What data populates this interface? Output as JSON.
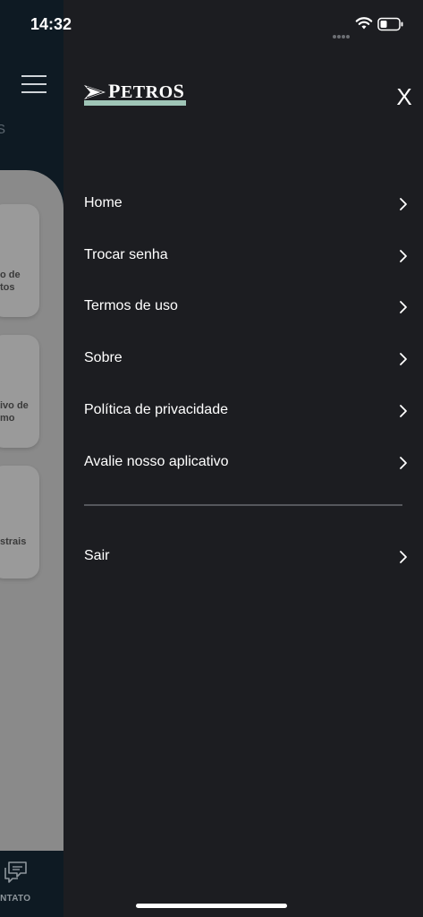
{
  "status_bar": {
    "time": "14:32"
  },
  "background_app": {
    "header_char": "S",
    "cards": [
      {
        "line1": "o de",
        "line2": "tos"
      },
      {
        "line1": "ivo de",
        "line2": "mo"
      },
      {
        "line1": "strais",
        "line2": ""
      }
    ],
    "bottom_tab_label": "ONTATO"
  },
  "drawer": {
    "logo": {
      "text_first": "P",
      "text_rest": "ETRO",
      "text_last": "S"
    },
    "close_label": "X",
    "menu_items": [
      {
        "label": "Home"
      },
      {
        "label": "Trocar senha"
      },
      {
        "label": "Termos de uso"
      },
      {
        "label": "Sobre"
      },
      {
        "label": "Política de privacidade"
      },
      {
        "label": "Avalie nosso aplicativo"
      }
    ],
    "logout": {
      "label": "Sair"
    }
  },
  "colors": {
    "drawer_bg": "#1c1d21",
    "logo_accent": "#9fc5b7",
    "divider": "#55575c"
  },
  "icons": {
    "menu_chevron": "chevron-right-icon",
    "close": "close-icon"
  }
}
